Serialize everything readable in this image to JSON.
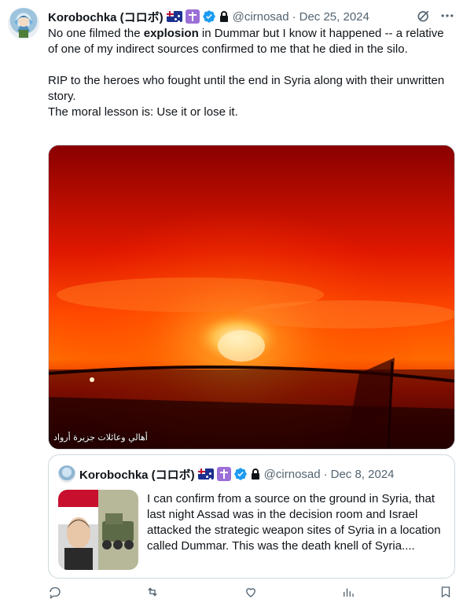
{
  "tweet": {
    "author_name": "Korobochka (コロボ)",
    "handle": "@cirnosad",
    "separator": "·",
    "date": "Dec 25, 2024",
    "text_line1_pre": "No one filmed the ",
    "text_line1_bold": "explosion",
    "text_line1_post": " in Dummar but I know it happened -- a relative of one of my indirect sources confirmed to me that he died in the silo.",
    "text_line2": "RIP to the heroes who fought until the end in Syria along with their unwritten story.",
    "text_line3": "The moral lesson is: Use it or lose it."
  },
  "media": {
    "watermark": "أهالي وعائلات جزيرة أرواد"
  },
  "quoted_tweet": {
    "author_name": "Korobochka (コロボ)",
    "handle": "@cirnosad",
    "separator": "·",
    "date": "Dec 8, 2024",
    "text": "I can confirm from a source on the ground in Syria, that last night Assad was in the decision room and Israel attacked the strategic weapon sites of Syria in a location called Dummar. This was the death knell of Syria...."
  },
  "icons": {
    "grok": "grok-icon",
    "more": "more-icon",
    "verified": "verified-badge-icon",
    "lock": "lock-icon",
    "flag": "australia-flag-emoji",
    "cross": "latin-cross-emoji"
  },
  "colors": {
    "text": "#0f1419",
    "secondary": "#536471",
    "verified": "#1d9bf0",
    "border": "#cfd9de"
  }
}
